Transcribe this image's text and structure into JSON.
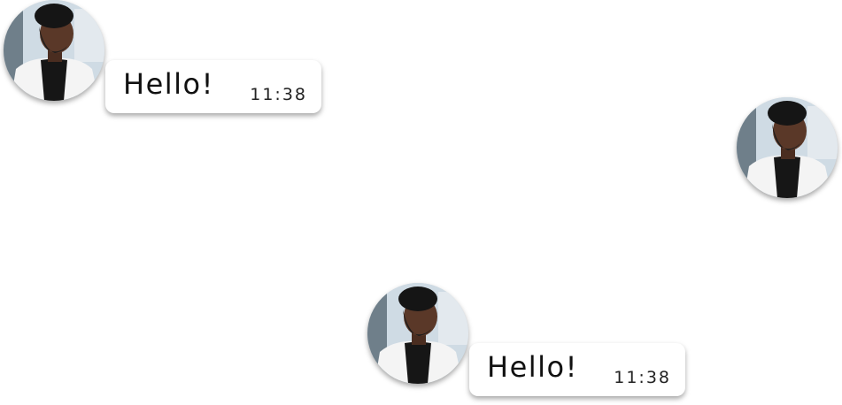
{
  "messages": [
    {
      "text": "Hello!",
      "time": "11:38"
    },
    {
      "text": "",
      "time": ""
    },
    {
      "text": "Hello!",
      "time": "11:38"
    }
  ]
}
